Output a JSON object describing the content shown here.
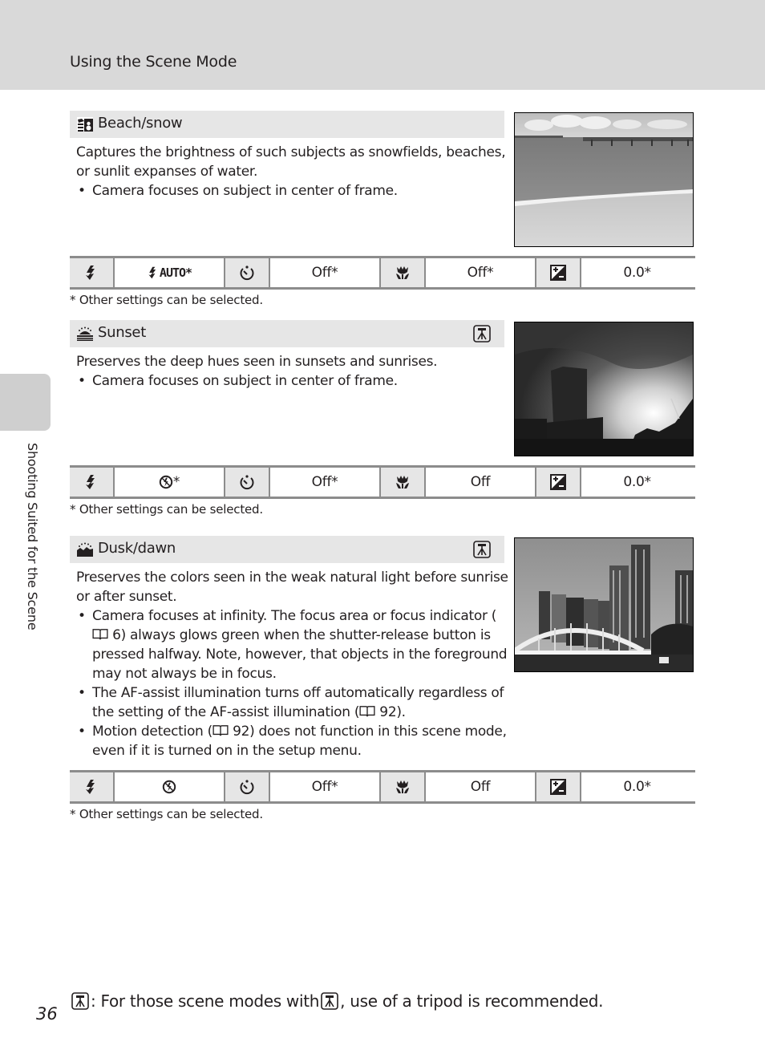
{
  "header": {
    "title": "Using the Scene Mode"
  },
  "side_tab": {
    "label": "Shooting Suited for the Scene"
  },
  "icons": {
    "flash": "flash-mode-icon",
    "self_timer": "self-timer-icon",
    "macro": "macro-mode-icon",
    "exposure": "exposure-compensation-icon",
    "tripod": "tripod-icon",
    "reference": "book-reference-icon"
  },
  "sections": [
    {
      "id": "beach-snow",
      "mode_icon": "beach-snow-icon",
      "title": "Beach/snow",
      "tripod_recommended": false,
      "description": "Captures the brightness of such subjects as snowfields, beaches, or sunlit expanses of water.",
      "bullets": [
        "Camera focuses on subject in center of frame."
      ],
      "photo": "beach-photo",
      "settings": {
        "flash": "AUTO*",
        "flash_icon": "flash-auto-icon",
        "self_timer": "Off*",
        "macro": "Off*",
        "exposure": "0.0*"
      },
      "footnote": "*  Other settings can be selected."
    },
    {
      "id": "sunset",
      "mode_icon": "sunset-icon",
      "title": "Sunset",
      "tripod_recommended": true,
      "description": "Preserves the deep hues seen in sunsets and sunrises.",
      "bullets": [
        "Camera focuses on subject in center of frame."
      ],
      "photo": "sunset-photo",
      "settings": {
        "flash": "*",
        "flash_icon": "flash-off-icon",
        "self_timer": "Off*",
        "macro": "Off",
        "exposure": "0.0*"
      },
      "footnote": "*  Other settings can be selected."
    },
    {
      "id": "dusk-dawn",
      "mode_icon": "dusk-dawn-icon",
      "title": "Dusk/dawn",
      "tripod_recommended": true,
      "description": "Preserves the colors seen in the weak natural light before sunrise or after sunset.",
      "bullets": [
        "Camera focuses at infinity. The focus area or focus indicator (",
        "6) always glows green when the shutter-release button is pressed halfway. Note, however, that objects in the foreground may not always be in focus.",
        "The AF-assist illumination turns off automatically regardless of the setting of the AF-assist illumination (",
        "92).",
        "Motion detection (",
        "92) does not function in this scene mode, even if it is turned on in the setup menu."
      ],
      "photo": "dusk-city-photo",
      "settings": {
        "flash": "",
        "flash_icon": "flash-off-icon",
        "self_timer": "Off*",
        "macro": "Off",
        "exposure": "0.0*"
      },
      "footnote": "*  Other settings can be selected."
    }
  ],
  "footer": {
    "page_number": "36",
    "note_part1": ": For those scene modes with ",
    "note_part2": ", use of a tripod is recommended."
  }
}
